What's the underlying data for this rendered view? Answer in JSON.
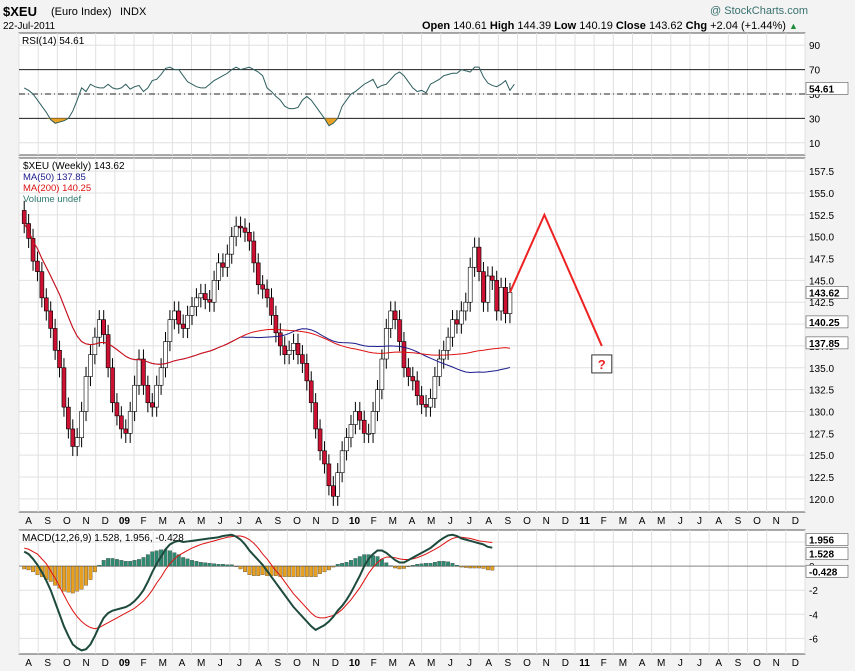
{
  "header": {
    "symbol": "$XEU",
    "name": "(Euro Index)",
    "exchange": "INDX",
    "date": "22-Jul-2011",
    "watermark": "@ StockCharts.com",
    "open_label": "Open",
    "open": "140.61",
    "high_label": "High",
    "high": "144.39",
    "low_label": "Low",
    "low": "140.19",
    "close_label": "Close",
    "close": "143.62",
    "chg_label": "Chg",
    "chg": "+2.04 (+1.44%)",
    "chg_arrow": "▲"
  },
  "colors": {
    "up": "#ffffff",
    "down": "#cc1133",
    "ma50": "#1a1a8c",
    "ma200": "#dd1111",
    "rsi_line": "#2e5e5e",
    "rsi_fill": "#e8a020",
    "macd_line": "#1e4a3e",
    "signal": "#dd1111",
    "hist_pos": "#2e8b72",
    "hist_neg": "#e8a020",
    "projection": "#ee2222"
  },
  "x_axis_labels": [
    "A",
    "S",
    "O",
    "N",
    "D",
    "09",
    "F",
    "M",
    "A",
    "M",
    "J",
    "J",
    "A",
    "S",
    "O",
    "N",
    "D",
    "10",
    "F",
    "M",
    "A",
    "M",
    "J",
    "J",
    "A",
    "S",
    "O",
    "N",
    "D",
    "11",
    "F",
    "M",
    "A",
    "M",
    "J",
    "J",
    "A",
    "S",
    "O",
    "N",
    "D"
  ],
  "chart_data": [
    {
      "type": "line",
      "panel": "RSI",
      "title": "RSI(14) 54.61",
      "ylim": [
        0,
        100
      ],
      "yticks": [
        10,
        30,
        50,
        70,
        90
      ],
      "levels": [
        30,
        70
      ],
      "midline": 50,
      "last_value": 54.61,
      "series": [
        {
          "values": [
            55,
            53,
            50,
            45,
            40,
            35,
            29,
            26,
            27,
            28,
            30,
            36,
            45,
            55,
            52,
            58,
            56,
            55,
            55,
            58,
            55,
            54,
            55,
            58,
            54,
            56,
            57,
            52,
            55,
            61,
            62,
            66,
            71,
            72,
            70,
            70,
            65,
            60,
            58,
            56,
            55,
            55,
            58,
            61,
            63,
            65,
            67,
            70,
            72,
            70,
            71,
            72,
            70,
            68,
            65,
            55,
            52,
            48,
            45,
            40,
            38,
            38,
            39,
            45,
            48,
            45,
            40,
            35,
            30,
            24,
            26,
            30,
            40,
            45,
            50,
            52,
            55,
            58,
            60,
            62,
            55,
            57,
            58,
            62,
            66,
            68,
            65,
            60,
            55,
            52,
            53,
            51,
            58,
            60,
            62,
            65,
            66,
            67,
            67,
            70,
            69,
            68,
            72,
            72,
            64,
            59,
            57,
            56,
            58,
            61,
            53,
            58
          ]
        }
      ]
    },
    {
      "type": "candlestick",
      "panel": "price",
      "title": "$XEU (Weekly) 143.62",
      "legend": [
        "MA(50) 137.85",
        "MA(200) 140.25",
        "Volume undef"
      ],
      "ylim": [
        118.5,
        159
      ],
      "yticks": [
        120.0,
        122.5,
        125.0,
        127.5,
        130.0,
        132.5,
        135.0,
        137.5,
        140.0,
        142.5,
        145.0,
        147.5,
        150.0,
        152.5,
        155.0,
        157.5
      ],
      "last_close": 143.62,
      "ma50_last": 137.85,
      "ma200_last": 140.25,
      "close": [
        151.5,
        149.8,
        147.2,
        146.0,
        143.0,
        141.5,
        139.5,
        137.0,
        135.0,
        130.5,
        128.0,
        126.0,
        127.0,
        130.0,
        134.0,
        136.5,
        138.5,
        140.5,
        138.8,
        135.0,
        131.0,
        129.5,
        128.0,
        127.5,
        130.0,
        133.0,
        136.0,
        133.0,
        131.0,
        130.5,
        133.0,
        135.0,
        138.0,
        140.5,
        141.5,
        140.0,
        139.5,
        141.0,
        142.0,
        143.0,
        143.5,
        142.8,
        142.5,
        145.0,
        147.0,
        146.5,
        148.0,
        150.0,
        151.2,
        151.0,
        150.5,
        149.5,
        147.0,
        144.5,
        144.0,
        143.0,
        141.0,
        139.0,
        137.5,
        136.5,
        137.0,
        137.8,
        136.5,
        135.5,
        133.5,
        131.0,
        128.0,
        125.5,
        124.0,
        121.5,
        120.3,
        123.0,
        125.5,
        127.0,
        128.5,
        130.0,
        129.0,
        127.5,
        127.5,
        130.0,
        132.5,
        136.0,
        139.5,
        141.5,
        140.5,
        138.0,
        135.0,
        134.0,
        133.5,
        131.8,
        130.8,
        130.5,
        131.5,
        134.0,
        136.0,
        137.0,
        138.5,
        140.5,
        140.0,
        141.5,
        142.5,
        146.5,
        148.8,
        146.0,
        142.5,
        145.5,
        145.0,
        141.5,
        144.2,
        141.2,
        143.62
      ],
      "projection": {
        "points": [
          [
            0,
            143.62
          ],
          [
            3,
            152.5
          ],
          [
            8,
            137.5
          ]
        ],
        "label": "?"
      }
    },
    {
      "type": "line",
      "panel": "MACD",
      "title": "MACD(12,26,9) 1.528, 1.956, -0.428",
      "ylim": [
        -7.3,
        3.0
      ],
      "yticks": [
        -6,
        -4,
        -2,
        0,
        2
      ],
      "macd_last": 1.528,
      "signal_last": 1.956,
      "hist_last": -0.428,
      "series": [
        {
          "name": "MACD",
          "values": [
            1.2,
            1.0,
            0.6,
            0.1,
            -0.5,
            -1.2,
            -2.0,
            -3.0,
            -4.0,
            -5.0,
            -5.8,
            -6.5,
            -6.8,
            -7.0,
            -6.9,
            -6.5,
            -5.8,
            -5.0,
            -4.3,
            -3.9,
            -3.7,
            -3.6,
            -3.5,
            -3.4,
            -3.2,
            -2.9,
            -2.5,
            -2.0,
            -1.3,
            -0.5,
            0.2,
            0.8,
            1.4,
            1.8,
            2.0,
            2.1,
            2.0,
            2.05,
            2.1,
            2.15,
            2.2,
            2.25,
            2.3,
            2.35,
            2.4,
            2.5,
            2.55,
            2.6,
            2.45,
            2.2,
            1.8,
            1.3,
            0.9,
            0.5,
            0.1,
            -0.4,
            -0.9,
            -1.4,
            -1.9,
            -2.4,
            -2.9,
            -3.4,
            -3.8,
            -4.2,
            -4.6,
            -5.0,
            -5.3,
            -5.1,
            -4.9,
            -4.6,
            -4.2,
            -3.7,
            -3.3,
            -2.8,
            -2.2,
            -1.5,
            -0.8,
            0.0,
            0.6,
            1.0,
            1.3,
            1.3,
            1.1,
            0.8,
            0.5,
            0.3,
            0.3,
            0.5,
            0.7,
            0.9,
            1.1,
            1.3,
            1.5,
            1.8,
            2.1,
            2.35,
            2.55,
            2.6,
            2.5,
            2.3,
            2.2,
            2.1,
            2.0,
            1.9,
            1.8,
            1.6,
            1.53
          ]
        },
        {
          "name": "Signal",
          "values": [
            1.5,
            1.4,
            1.2,
            1.0,
            0.6,
            0.2,
            -0.4,
            -1.0,
            -1.7,
            -2.4,
            -3.1,
            -3.7,
            -4.2,
            -4.6,
            -4.9,
            -5.1,
            -5.2,
            -5.1,
            -4.9,
            -4.7,
            -4.5,
            -4.3,
            -4.1,
            -3.9,
            -3.7,
            -3.5,
            -3.2,
            -2.9,
            -2.5,
            -2.0,
            -1.4,
            -0.9,
            -0.3,
            0.2,
            0.6,
            0.9,
            1.1,
            1.3,
            1.5,
            1.65,
            1.8,
            1.9,
            2.0,
            2.1,
            2.2,
            2.3,
            2.4,
            2.45,
            2.5,
            2.5,
            2.4,
            2.2,
            1.9,
            1.5,
            1.0,
            0.6,
            0.1,
            -0.4,
            -0.8,
            -1.3,
            -1.8,
            -2.3,
            -2.7,
            -3.1,
            -3.5,
            -3.9,
            -4.2,
            -4.3,
            -4.3,
            -4.2,
            -4.1,
            -3.9,
            -3.6,
            -3.2,
            -2.8,
            -2.3,
            -1.8,
            -1.2,
            -0.6,
            -0.1,
            0.3,
            0.6,
            0.75,
            0.75,
            0.7,
            0.6,
            0.55,
            0.55,
            0.6,
            0.7,
            0.85,
            1.0,
            1.2,
            1.4,
            1.6,
            1.85,
            2.1,
            2.3,
            2.4,
            2.4,
            2.35,
            2.3,
            2.2,
            2.1,
            2.05,
            2.0,
            1.96
          ]
        }
      ]
    }
  ]
}
